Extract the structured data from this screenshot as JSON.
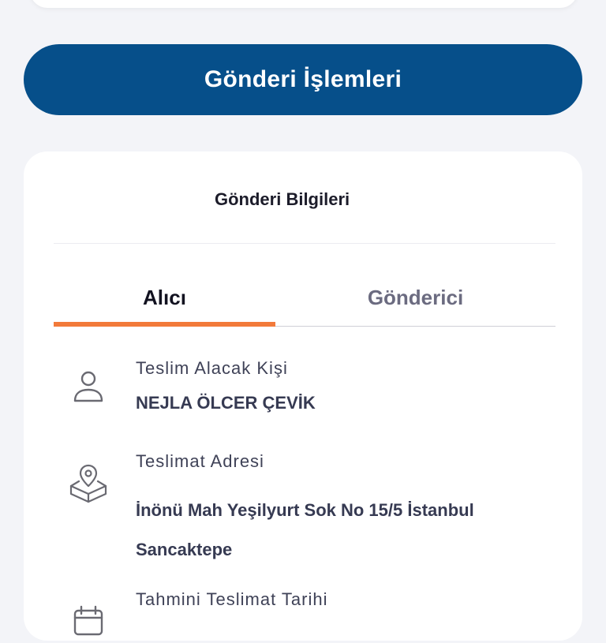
{
  "actions": {
    "shipment_operations_label": "Gönderi İşlemleri"
  },
  "info_card": {
    "title": "Gönderi Bilgileri",
    "tabs": [
      {
        "label": "Alıcı",
        "active": true
      },
      {
        "label": "Gönderici",
        "active": false
      }
    ],
    "recipient": {
      "icon": "person-icon",
      "label": "Teslim Alacak Kişi",
      "value": "NEJLA ÖLCER ÇEVİK"
    },
    "address": {
      "icon": "map-pin-box-icon",
      "label": "Teslimat Adresi",
      "line1": "İnönü Mah Yeşilyurt Sok No 15/5 İstanbul",
      "line2": "Sancaktepe"
    },
    "delivery_date": {
      "icon": "calendar-icon",
      "label": "Tahmini Teslimat Tarihi"
    }
  },
  "colors": {
    "primary": "#064f8a",
    "tab_indicator": "#f27a3a",
    "background": "#f3f4f8"
  }
}
